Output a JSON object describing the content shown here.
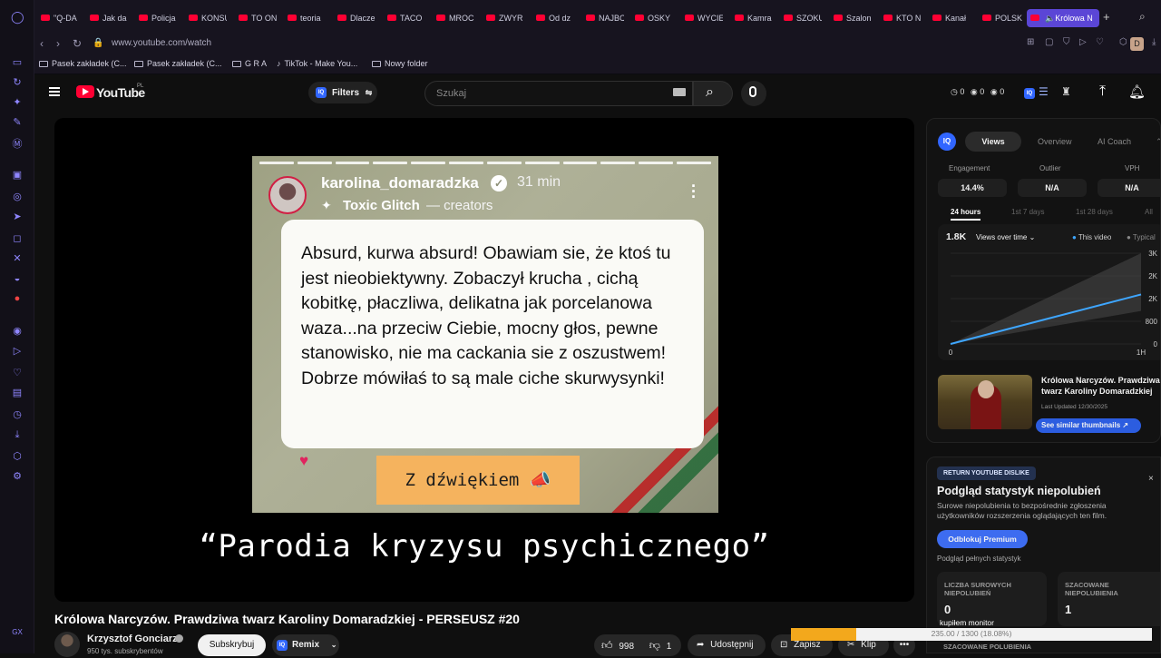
{
  "browser": {
    "tabs": [
      {
        "label": "\"Q-DA"
      },
      {
        "label": "Jak da"
      },
      {
        "label": "Policja"
      },
      {
        "label": "KONSU"
      },
      {
        "label": "TO ON"
      },
      {
        "label": "teoria"
      },
      {
        "label": "Dlacze"
      },
      {
        "label": "TACO"
      },
      {
        "label": "MROC"
      },
      {
        "label": "ZWYR"
      },
      {
        "label": "Od dz"
      },
      {
        "label": "NAJBC"
      },
      {
        "label": "OSKY"
      },
      {
        "label": "WYCIE"
      },
      {
        "label": "Kamra"
      },
      {
        "label": "SZOKU"
      },
      {
        "label": "Szalon"
      },
      {
        "label": "KTO N"
      },
      {
        "label": "Kanał"
      },
      {
        "label": "POLSK"
      },
      {
        "label": "Królowa N"
      }
    ],
    "new_tab": "+",
    "url": "www.youtube.com/watch",
    "profile_initial": "D",
    "bookmarks": [
      {
        "label": "Pasek zakładek (C..."
      },
      {
        "label": "Pasek zakładek (C..."
      },
      {
        "label": "G R A"
      },
      {
        "label": "TikTok - Make You..."
      },
      {
        "label": "Nowy folder"
      }
    ]
  },
  "youtube": {
    "brand": "YouTube",
    "region": "PL",
    "filters_label": "Filters",
    "search_placeholder": "Szukaj",
    "counters": [
      "0",
      "0",
      "0"
    ],
    "iq_badge": "IQ"
  },
  "video": {
    "story": {
      "username": "karolina_domaradzka",
      "time": "31 min",
      "sub_bold": "Toxic Glitch",
      "sub_tail": "— creators",
      "text": "Absurd, kurwa absurd! Obawiam sie, że ktoś tu jest nieobiektywny. Zobaczył krucha , cichą kobitkę, płaczliwa, delikatna jak porcelanowa waza...na przeciw Ciebie, mocny głos, pewne stanowisko, nie ma cackania sie z oszustwem! Dobrze mówiłaś  to są male ciche skurwysynki!",
      "sound_button": "Z dźwiękiem 📣"
    },
    "caption": "“Parodia kryzysu psychicznego”",
    "title": "Królowa Narcyzów. Prawdziwa twarz Karoliny Domaradzkiej - PERSEUSZ #20",
    "channel": "Krzysztof Gonciarz",
    "subscribers": "950 tys. subskrybentów",
    "subscribe_label": "Subskrybuj",
    "remix_label": "Remix",
    "likes": "998",
    "dislikes": "1",
    "share_label": "Udostępnij",
    "save_label": "Zapisz",
    "clip_label": "Klip",
    "more_label": "•••"
  },
  "vidiq": {
    "tabs": [
      "Views",
      "Overview",
      "AI Coach"
    ],
    "metrics": [
      {
        "label": "Engagement",
        "value": "14.4%"
      },
      {
        "label": "Outlier",
        "value": "N/A"
      },
      {
        "label": "VPH",
        "value": "N/A"
      }
    ],
    "time_tabs": [
      "24 hours",
      "1st 7 days",
      "1st 28 days",
      "All"
    ],
    "total_views": "1.8K",
    "views_dropdown": "Views over time",
    "legend": [
      "This video",
      "Typical"
    ],
    "thumb_title": "Królowa Narcyzów. Prawdziwa twarz Karoliny Domaradzkiej",
    "last_updated": "Last Updated 12/30/2025",
    "similar_button": "See similar thumbnails ↗",
    "colors": {
      "this_video": "#3ea6ff",
      "typical_band": "#4a4a4a"
    }
  },
  "chart_data": {
    "type": "area",
    "title": "",
    "xlabel": "",
    "ylabel": "",
    "x_ticks": [
      "0",
      "1H"
    ],
    "y_ticks": [
      "3K",
      "2K",
      "2K",
      "800",
      "0"
    ],
    "series": [
      {
        "name": "This video",
        "x": [
          0,
          1
        ],
        "y": [
          0,
          1800
        ]
      },
      {
        "name": "Typical",
        "x": [
          0,
          1
        ],
        "y_low": [
          0,
          1200
        ],
        "y_high": [
          0,
          3300
        ]
      }
    ],
    "ylim": [
      0,
      3300
    ],
    "grid": true
  },
  "ryd": {
    "badge": "RETURN YOUTUBE DISLIKE",
    "close": "×",
    "title": "Podgląd statystyk niepolubień",
    "desc": "Surowe niepolubienia to bezpośrednie zgłoszenia użytkowników rozszerzenia oglądających ten film.",
    "unlock_button": "Odblokuj Premium",
    "full_stats_link": "Podgląd pełnych statystyk",
    "box1_label": "LICZBA SUROWYCH NIEPOLUBIEŃ",
    "box1_value": "0",
    "box2_label": "SZACOWANE NIEPOLUBIENIA",
    "box2_value": "1",
    "bottom_label": "SZACOWANE POLUBIENIA"
  },
  "overlay": {
    "monitor_text": "kupiłem monitor",
    "progress_text": "235.00 / 1300 (18.08%)",
    "progress_fraction": 0.1808
  }
}
